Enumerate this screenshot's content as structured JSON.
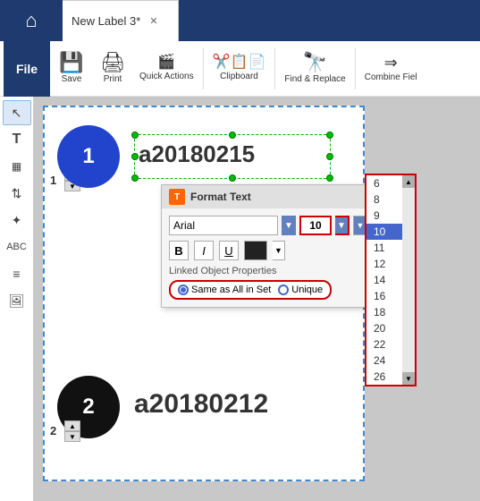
{
  "title_bar": {
    "home_icon": "⌂",
    "tab_label": "New Label 3*",
    "tab_close": "✕"
  },
  "toolbar": {
    "file_label": "File",
    "save_label": "Save",
    "save_icon": "💾",
    "print_label": "Print",
    "print_icon": "🖨",
    "quick_actions_label": "Quick Actions",
    "quick_actions_icon": "⚙",
    "clipboard_label": "Clipboard",
    "clipboard_icon": "📋",
    "find_replace_label": "Find & Replace",
    "find_replace_icon": "🔍",
    "combine_label": "Combine Fiel",
    "combine_icon": "▶▶"
  },
  "canvas": {
    "obj1_number": "1",
    "obj1_circle_label": "1",
    "obj2_number": "2",
    "obj2_circle_label": "2",
    "text1": "a20180215",
    "text2": "a20180212"
  },
  "format_panel": {
    "title": "Format Text",
    "font_name": "Arial",
    "font_size": "10",
    "bold_label": "B",
    "italic_label": "I",
    "underline_label": "U",
    "linked_object_label": "Linked Object Properties",
    "radio_same": "Same as All in Set",
    "radio_unique": "Unique"
  },
  "size_list": {
    "items": [
      "6",
      "8",
      "9",
      "10",
      "11",
      "12",
      "14",
      "16",
      "18",
      "20",
      "22",
      "24",
      "26"
    ],
    "selected": "10"
  }
}
